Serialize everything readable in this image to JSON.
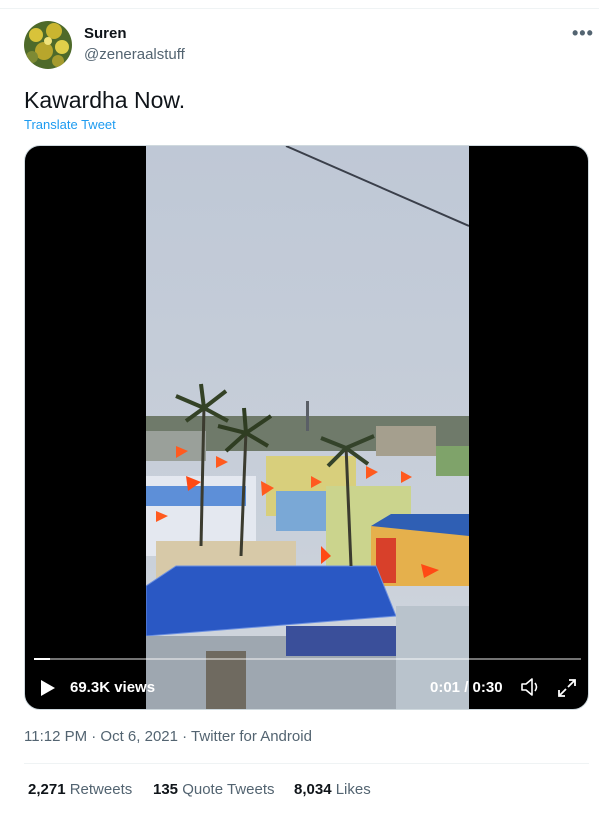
{
  "user": {
    "display_name": "Suren",
    "handle": "@zeneraalstuff"
  },
  "tweet": {
    "text": "Kawardha Now.",
    "translate_label": "Translate Tweet",
    "more_icon": "more-horizontal-icon"
  },
  "video": {
    "views": "69.3K views",
    "time": "0:01 / 0:30",
    "progress": 0.03,
    "icons": [
      "play-icon",
      "volume-icon",
      "fullscreen-icon"
    ]
  },
  "meta": {
    "line": "11:12 PM · Oct 6, 2021 · Twitter for Android"
  },
  "stats": {
    "retweets_count": "2,271",
    "retweets_label": "Retweets",
    "quotes_count": "135",
    "quotes_label": "Quote Tweets",
    "likes_count": "8,034",
    "likes_label": "Likes"
  },
  "colors": {
    "link": "#1d9bf0",
    "secondary_text": "#536471",
    "primary_text": "#0f1419"
  }
}
